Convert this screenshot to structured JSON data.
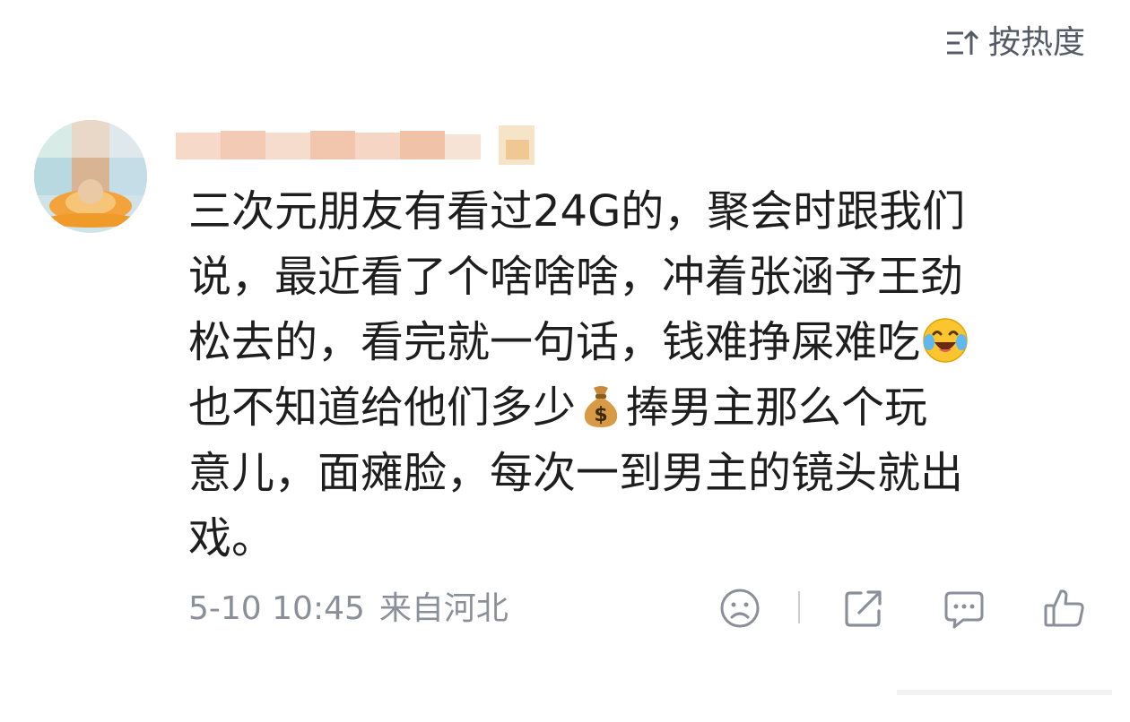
{
  "sort": {
    "label": "按热度",
    "icon": "sort-descending-icon"
  },
  "comment": {
    "author": {
      "avatar_icon": "avatar-image",
      "name_obscured": true
    },
    "lines": [
      [
        "三次元朋友有看过24G的，聚会时跟我们"
      ],
      [
        "说，最近看了个啥啥啥，冲着张涵予王劲"
      ],
      [
        "松去的，看完就一句话，钱难挣屎难吃",
        {
          "emoji": "laughing-crying-emoji"
        }
      ],
      [
        "也不知道给他们多少",
        {
          "emoji": "money-bag-emoji"
        },
        "捧男主那么个玩"
      ],
      [
        "意儿，面瘫脸，每次一到男主的镜头就出"
      ],
      [
        "戏。"
      ]
    ],
    "timestamp": "5-10 10:45",
    "location": "来自河北"
  },
  "actions": [
    {
      "name": "dislike-face-icon"
    },
    {
      "name": "share-icon"
    },
    {
      "name": "reply-comment-icon"
    },
    {
      "name": "like-thumb-icon"
    }
  ],
  "colors": {
    "icon": "#8a8f99",
    "sort_text": "#555b66",
    "body_text": "#1e1e1e",
    "meta_text": "#8a8f99"
  }
}
